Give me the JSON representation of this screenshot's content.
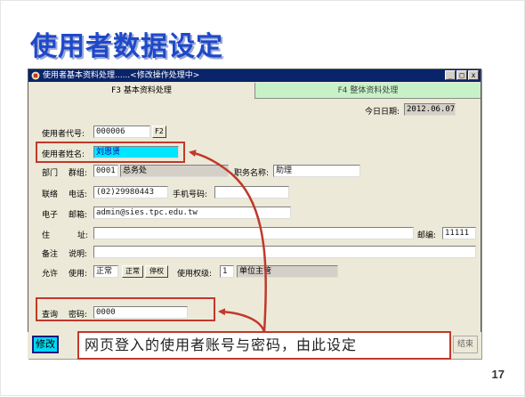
{
  "slide": {
    "title": "使用者数据设定",
    "page_number": "17"
  },
  "window": {
    "title": "使用者基本资料处理......<修改操作处理中>",
    "controls": [
      "_",
      "□",
      "x"
    ],
    "tabs": [
      {
        "label": "F3 基本资料处理",
        "active": true
      },
      {
        "label": "F4 整体资料处理",
        "active": false
      }
    ]
  },
  "form": {
    "today_label": "今日日期:",
    "today_value": "2012.06.07",
    "user_code_label": "使用者代号:",
    "user_code_value": "000006",
    "user_code_btn": "F2",
    "user_name_label": "使用者姓名:",
    "user_name_value": "刘恩贤",
    "dept_label": "部门",
    "group_label": "群组:",
    "group_code": "0001",
    "group_name": "总务处",
    "job_label": "职务名称:",
    "job_value": "助理",
    "contact_label": "联络",
    "phone_label": "电话:",
    "phone_value": "(02)29980443",
    "mobile_label": "手机号码:",
    "mobile_value": "",
    "email_section_label": "电子",
    "email_label": "邮箱:",
    "email_value": "admin@sies.tpc.edu.tw",
    "address_section_label": "住",
    "address_label": "址:",
    "address_value": "",
    "zip_label": "邮编:",
    "zip_value": "11111",
    "note_section_label": "备注",
    "note_label": "说明:",
    "note_value": "",
    "permit_section_label": "允许",
    "usage_label": "使用:",
    "usage_value": "正常",
    "normal_btn": "正常",
    "stop_btn": "停权",
    "level_label": "使用权级:",
    "level_value": "1",
    "level_name": "单位主管",
    "query_label": "查询",
    "password_label": "密码:",
    "password_value": "0000"
  },
  "bottom": {
    "modify_btn": "修改",
    "callout_text": "网页登入的使用者账号与密码，由此设定",
    "partial_btn": "结束"
  },
  "colors": {
    "title_blue": "#1f49c8",
    "highlight_cyan": "#00e6ff",
    "annotation_red": "#c0392b",
    "titlebar_navy": "#0a246a",
    "tab_green": "#c7f2c7"
  }
}
